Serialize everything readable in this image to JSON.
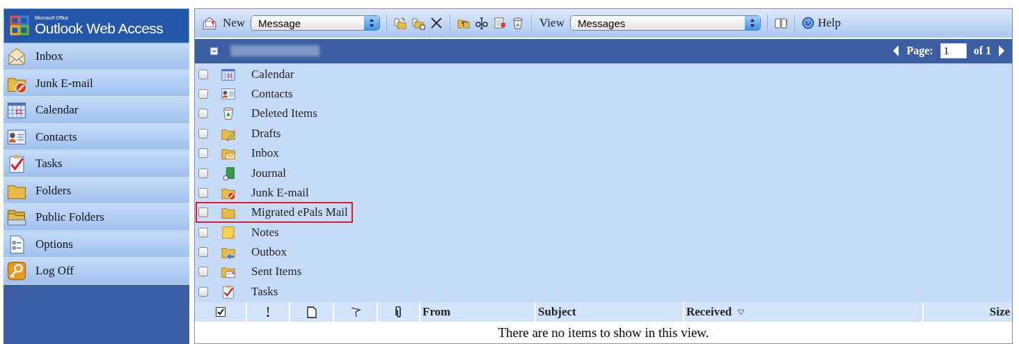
{
  "sidebar": {
    "logo": {
      "brand": "Microsoft Office",
      "title": "Outlook Web Access"
    },
    "items": [
      {
        "label": "Inbox",
        "kind": "inbox"
      },
      {
        "label": "Junk E-mail",
        "kind": "junk"
      },
      {
        "label": "Calendar",
        "kind": "calendar"
      },
      {
        "label": "Contacts",
        "kind": "contacts"
      },
      {
        "label": "Tasks",
        "kind": "tasks"
      },
      {
        "label": "Folders",
        "kind": "folder"
      },
      {
        "label": "Public Folders",
        "kind": "public"
      },
      {
        "label": "Options",
        "kind": "options"
      },
      {
        "label": "Log Off",
        "kind": "key"
      }
    ]
  },
  "toolbar": {
    "new_label": "New",
    "new_select": "Message",
    "view_label": "View",
    "view_select": "Messages",
    "help_label": "Help"
  },
  "folder_bar": {
    "expanded": true
  },
  "pager": {
    "label": "Page:",
    "value": "1",
    "total": "of 1"
  },
  "folders": [
    {
      "name": "Calendar",
      "kind": "calendar",
      "checked": false,
      "highlighted": false
    },
    {
      "name": "Contacts",
      "kind": "contacts",
      "checked": false,
      "highlighted": false
    },
    {
      "name": "Deleted Items",
      "kind": "trash",
      "checked": false,
      "highlighted": false
    },
    {
      "name": "Drafts",
      "kind": "drafts",
      "checked": false,
      "highlighted": false
    },
    {
      "name": "Inbox",
      "kind": "inbox-folder",
      "checked": false,
      "highlighted": false
    },
    {
      "name": "Journal",
      "kind": "journal",
      "checked": false,
      "highlighted": false
    },
    {
      "name": "Junk E-mail",
      "kind": "junk",
      "checked": false,
      "highlighted": false
    },
    {
      "name": "Migrated ePals Mail",
      "kind": "folder",
      "checked": false,
      "highlighted": true
    },
    {
      "name": "Notes",
      "kind": "notes",
      "checked": false,
      "highlighted": false
    },
    {
      "name": "Outbox",
      "kind": "outbox",
      "checked": false,
      "highlighted": false
    },
    {
      "name": "Sent Items",
      "kind": "sent",
      "checked": false,
      "highlighted": false
    },
    {
      "name": "Tasks",
      "kind": "tasks",
      "checked": false,
      "highlighted": false
    }
  ],
  "columns": [
    {
      "kind": "checkbox",
      "checked": true
    },
    {
      "kind": "importance"
    },
    {
      "kind": "item-type"
    },
    {
      "kind": "flag"
    },
    {
      "kind": "attachment"
    },
    {
      "kind": "text",
      "label": "From",
      "sorted": false
    },
    {
      "kind": "text",
      "label": "Subject",
      "sorted": false
    },
    {
      "kind": "text",
      "label": "Received",
      "sorted": true
    },
    {
      "kind": "text",
      "label": "Size",
      "sorted": false
    }
  ],
  "empty_message": "There are no items to show in this view."
}
